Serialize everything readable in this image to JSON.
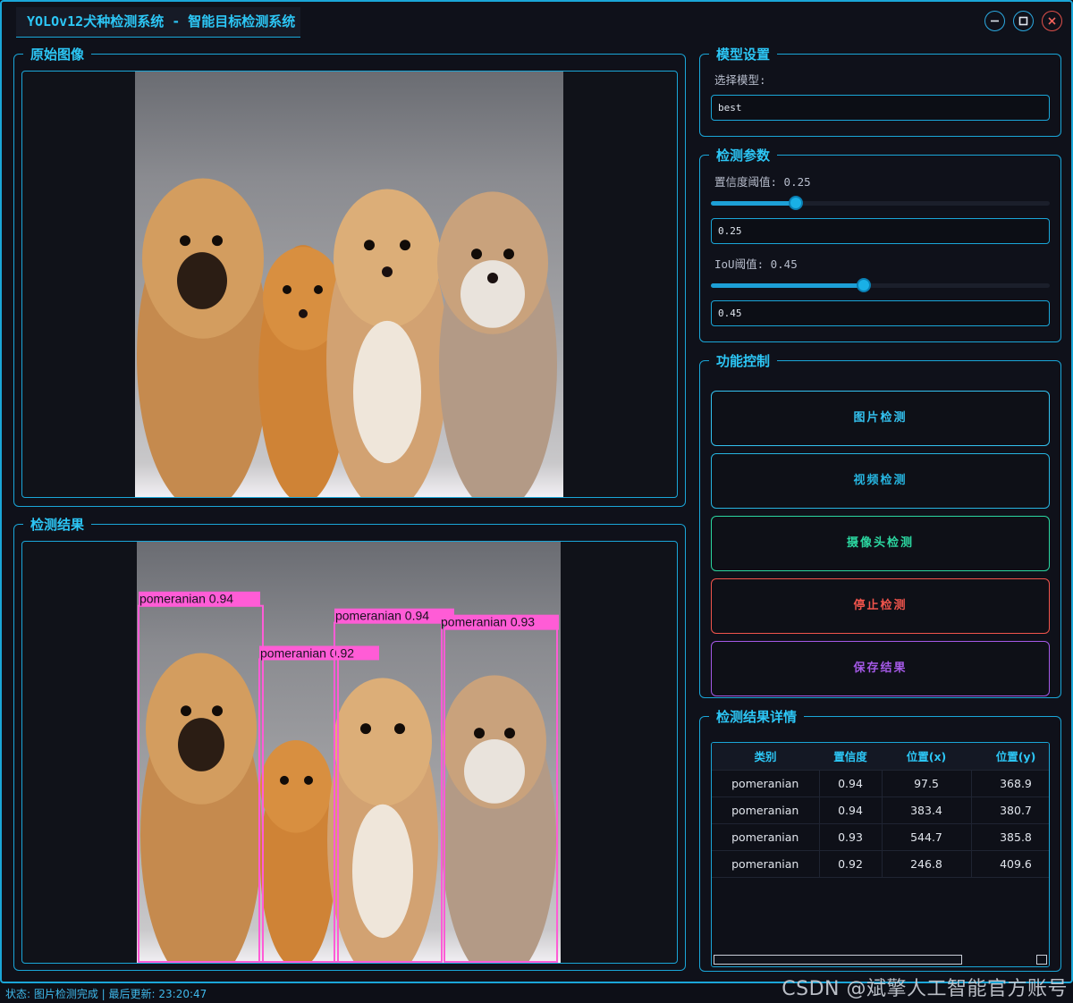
{
  "window": {
    "title": "YOLOv12犬种检测系统 - 智能目标检测系统",
    "controls": {
      "minimize": "minimize-icon",
      "maximize": "maximize-icon",
      "close": "close-icon"
    }
  },
  "original_panel": {
    "title": "原始图像"
  },
  "result_panel": {
    "title": "检测结果",
    "detections": [
      {
        "label": "pomeranian 0.94"
      },
      {
        "label": "pomeranian 0.92"
      },
      {
        "label": "pomeranian 0.94"
      },
      {
        "label": "pomeranian 0.93"
      }
    ]
  },
  "model_settings": {
    "title": "模型设置",
    "select_label": "选择模型:",
    "model_value": "best"
  },
  "params": {
    "title": "检测参数",
    "confidence": {
      "label": "置信度阈值: 0.25",
      "value": 0.25,
      "input": "0.25"
    },
    "iou": {
      "label": "IoU阈值: 0.45",
      "value": 0.45,
      "input": "0.45"
    }
  },
  "controls": {
    "title": "功能控制",
    "buttons": [
      {
        "label": "图片检测",
        "color": "#33c2f0"
      },
      {
        "label": "视频检测",
        "color": "#26b5e0"
      },
      {
        "label": "摄像头检测",
        "color": "#2bd6a0"
      },
      {
        "label": "停止检测",
        "color": "#f0544c"
      },
      {
        "label": "保存结果",
        "color": "#a459e6"
      }
    ]
  },
  "details": {
    "title": "检测结果详情",
    "columns": [
      "类别",
      "置信度",
      "位置(x)",
      "位置(y)"
    ],
    "rows": [
      [
        "pomeranian",
        "0.94",
        "97.5",
        "368.9"
      ],
      [
        "pomeranian",
        "0.94",
        "383.4",
        "380.7"
      ],
      [
        "pomeranian",
        "0.93",
        "544.7",
        "385.8"
      ],
      [
        "pomeranian",
        "0.92",
        "246.8",
        "409.6"
      ]
    ]
  },
  "status": {
    "text": "状态: 图片检测完成 | 最后更新: 23:20:47"
  },
  "watermark": {
    "text": "CSDN @斌擎人工智能官方账号"
  },
  "colors": {
    "accent": "#1aa6d8",
    "box": "#ff5cd6",
    "stop": "#f0544c",
    "save": "#a459e6",
    "camera": "#2bd6a0"
  }
}
